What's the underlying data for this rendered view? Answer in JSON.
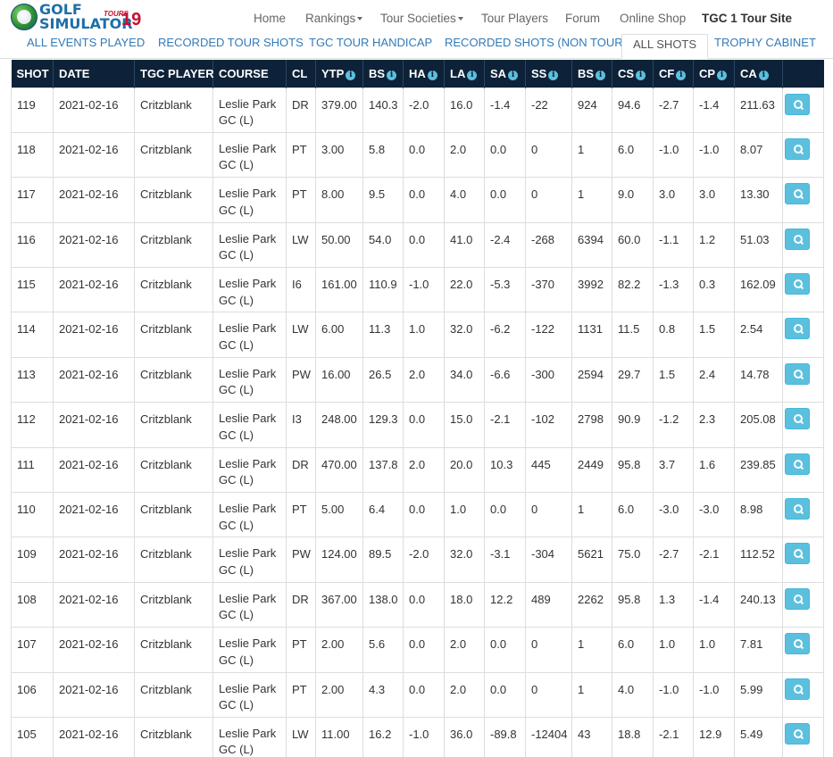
{
  "brand": {
    "line1": "GOLF",
    "line2": "SIMULATOR",
    "tours": "TOURS",
    "year": "19"
  },
  "nav": {
    "home": "Home",
    "rankings": "Rankings",
    "tour_societies": "Tour Societies",
    "tour_players": "Tour Players",
    "forum": "Forum",
    "online_shop": "Online Shop",
    "tour_site": "TGC 1 Tour Site"
  },
  "tabs": {
    "all_events": "ALL EVENTS PLAYED",
    "recorded_tour": "RECORDED TOUR SHOTS",
    "handicap": "TGC TOUR HANDICAP",
    "non_tour": "RECORDED SHOTS (NON TOUR)",
    "all_shots": "ALL SHOTS",
    "trophy": "TROPHY CABINET"
  },
  "columns": [
    "SHOT",
    "DATE",
    "TGC PLAYER",
    "COURSE",
    "CL",
    "YTP",
    "BS",
    "HA",
    "LA",
    "SA",
    "SS",
    "BS",
    "CS",
    "CF",
    "CP",
    "CA"
  ],
  "info_icon": "i",
  "rows": [
    {
      "shot": "119",
      "date": "2021-02-16",
      "player": "Critzblank",
      "course1": "Leslie Park",
      "course2": "GC (L)",
      "cl": "DR",
      "ytp": "379.00",
      "bs": "140.3",
      "ha": "-2.0",
      "la": "16.0",
      "sa": "-1.4",
      "ss": "-22",
      "bs2": "924",
      "cs": "94.6",
      "cf": "-2.7",
      "cp": "-1.4",
      "ca": "211.63"
    },
    {
      "shot": "118",
      "date": "2021-02-16",
      "player": "Critzblank",
      "course1": "Leslie Park",
      "course2": "GC (L)",
      "cl": "PT",
      "ytp": "3.00",
      "bs": "5.8",
      "ha": "0.0",
      "la": "2.0",
      "sa": "0.0",
      "ss": "0",
      "bs2": "1",
      "cs": "6.0",
      "cf": "-1.0",
      "cp": "-1.0",
      "ca": "8.07"
    },
    {
      "shot": "117",
      "date": "2021-02-16",
      "player": "Critzblank",
      "course1": "Leslie Park",
      "course2": "GC (L)",
      "cl": "PT",
      "ytp": "8.00",
      "bs": "9.5",
      "ha": "0.0",
      "la": "4.0",
      "sa": "0.0",
      "ss": "0",
      "bs2": "1",
      "cs": "9.0",
      "cf": "3.0",
      "cp": "3.0",
      "ca": "13.30"
    },
    {
      "shot": "116",
      "date": "2021-02-16",
      "player": "Critzblank",
      "course1": "Leslie Park",
      "course2": "GC (L)",
      "cl": "LW",
      "ytp": "50.00",
      "bs": "54.0",
      "ha": "0.0",
      "la": "41.0",
      "sa": "-2.4",
      "ss": "-268",
      "bs2": "6394",
      "cs": "60.0",
      "cf": "-1.1",
      "cp": "1.2",
      "ca": "51.03"
    },
    {
      "shot": "115",
      "date": "2021-02-16",
      "player": "Critzblank",
      "course1": "Leslie Park",
      "course2": "GC (L)",
      "cl": "I6",
      "ytp": "161.00",
      "bs": "110.9",
      "ha": "-1.0",
      "la": "22.0",
      "sa": "-5.3",
      "ss": "-370",
      "bs2": "3992",
      "cs": "82.2",
      "cf": "-1.3",
      "cp": "0.3",
      "ca": "162.09"
    },
    {
      "shot": "114",
      "date": "2021-02-16",
      "player": "Critzblank",
      "course1": "Leslie Park",
      "course2": "GC (L)",
      "cl": "LW",
      "ytp": "6.00",
      "bs": "11.3",
      "ha": "1.0",
      "la": "32.0",
      "sa": "-6.2",
      "ss": "-122",
      "bs2": "1131",
      "cs": "11.5",
      "cf": "0.8",
      "cp": "1.5",
      "ca": "2.54"
    },
    {
      "shot": "113",
      "date": "2021-02-16",
      "player": "Critzblank",
      "course1": "Leslie Park",
      "course2": "GC (L)",
      "cl": "PW",
      "ytp": "16.00",
      "bs": "26.5",
      "ha": "2.0",
      "la": "34.0",
      "sa": "-6.6",
      "ss": "-300",
      "bs2": "2594",
      "cs": "29.7",
      "cf": "1.5",
      "cp": "2.4",
      "ca": "14.78"
    },
    {
      "shot": "112",
      "date": "2021-02-16",
      "player": "Critzblank",
      "course1": "Leslie Park",
      "course2": "GC (L)",
      "cl": "I3",
      "ytp": "248.00",
      "bs": "129.3",
      "ha": "0.0",
      "la": "15.0",
      "sa": "-2.1",
      "ss": "-102",
      "bs2": "2798",
      "cs": "90.9",
      "cf": "-1.2",
      "cp": "2.3",
      "ca": "205.08"
    },
    {
      "shot": "111",
      "date": "2021-02-16",
      "player": "Critzblank",
      "course1": "Leslie Park",
      "course2": "GC (L)",
      "cl": "DR",
      "ytp": "470.00",
      "bs": "137.8",
      "ha": "2.0",
      "la": "20.0",
      "sa": "10.3",
      "ss": "445",
      "bs2": "2449",
      "cs": "95.8",
      "cf": "3.7",
      "cp": "1.6",
      "ca": "239.85"
    },
    {
      "shot": "110",
      "date": "2021-02-16",
      "player": "Critzblank",
      "course1": "Leslie Park",
      "course2": "GC (L)",
      "cl": "PT",
      "ytp": "5.00",
      "bs": "6.4",
      "ha": "0.0",
      "la": "1.0",
      "sa": "0.0",
      "ss": "0",
      "bs2": "1",
      "cs": "6.0",
      "cf": "-3.0",
      "cp": "-3.0",
      "ca": "8.98"
    },
    {
      "shot": "109",
      "date": "2021-02-16",
      "player": "Critzblank",
      "course1": "Leslie Park",
      "course2": "GC (L)",
      "cl": "PW",
      "ytp": "124.00",
      "bs": "89.5",
      "ha": "-2.0",
      "la": "32.0",
      "sa": "-3.1",
      "ss": "-304",
      "bs2": "5621",
      "cs": "75.0",
      "cf": "-2.7",
      "cp": "-2.1",
      "ca": "112.52"
    },
    {
      "shot": "108",
      "date": "2021-02-16",
      "player": "Critzblank",
      "course1": "Leslie Park",
      "course2": "GC (L)",
      "cl": "DR",
      "ytp": "367.00",
      "bs": "138.0",
      "ha": "0.0",
      "la": "18.0",
      "sa": "12.2",
      "ss": "489",
      "bs2": "2262",
      "cs": "95.8",
      "cf": "1.3",
      "cp": "-1.4",
      "ca": "240.13"
    },
    {
      "shot": "107",
      "date": "2021-02-16",
      "player": "Critzblank",
      "course1": "Leslie Park",
      "course2": "GC (L)",
      "cl": "PT",
      "ytp": "2.00",
      "bs": "5.6",
      "ha": "0.0",
      "la": "2.0",
      "sa": "0.0",
      "ss": "0",
      "bs2": "1",
      "cs": "6.0",
      "cf": "1.0",
      "cp": "1.0",
      "ca": "7.81"
    },
    {
      "shot": "106",
      "date": "2021-02-16",
      "player": "Critzblank",
      "course1": "Leslie Park",
      "course2": "GC (L)",
      "cl": "PT",
      "ytp": "2.00",
      "bs": "4.3",
      "ha": "0.0",
      "la": "2.0",
      "sa": "0.0",
      "ss": "0",
      "bs2": "1",
      "cs": "4.0",
      "cf": "-1.0",
      "cp": "-1.0",
      "ca": "5.99"
    },
    {
      "shot": "105",
      "date": "2021-02-16",
      "player": "Critzblank",
      "course1": "Leslie Park",
      "course2": "GC (L)",
      "cl": "LW",
      "ytp": "11.00",
      "bs": "16.2",
      "ha": "-1.0",
      "la": "36.0",
      "sa": "-89.8",
      "ss": "-12404",
      "bs2": "43",
      "cs": "18.8",
      "cf": "-2.1",
      "cp": "12.9",
      "ca": "5.49"
    }
  ]
}
